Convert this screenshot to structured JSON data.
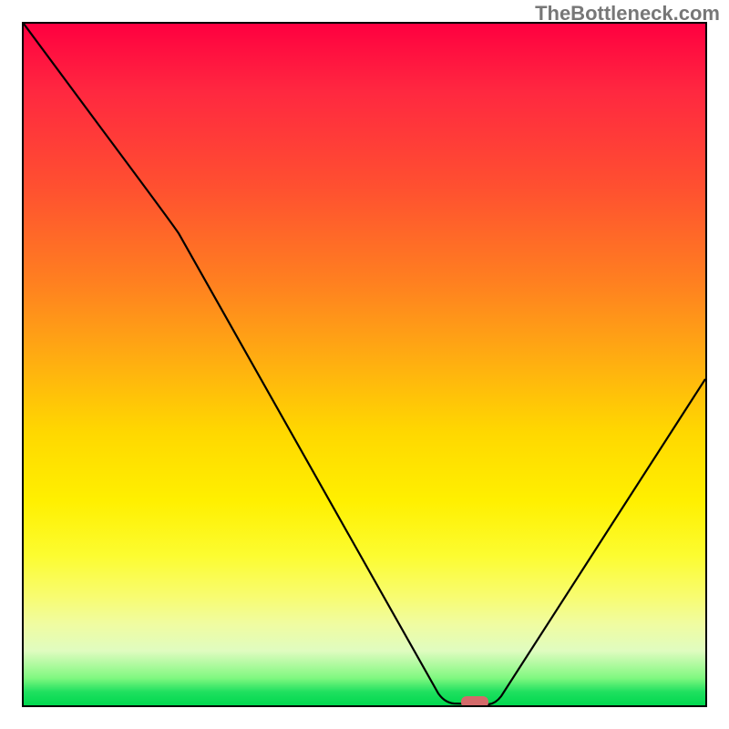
{
  "watermark": "TheBottleneck.com",
  "chart_data": {
    "type": "line",
    "title": "",
    "xlabel": "",
    "ylabel": "",
    "xlim": [
      0,
      100
    ],
    "ylim": [
      0,
      100
    ],
    "grid": false,
    "series": [
      {
        "name": "curve",
        "x": [
          0,
          22,
          62,
          63,
          69,
          70,
          100
        ],
        "y": [
          100,
          70,
          1,
          0,
          0,
          1,
          48
        ]
      }
    ],
    "marker": {
      "x": 66,
      "y": 0.5,
      "color": "#d46a6a",
      "shape": "rounded-rect"
    }
  },
  "colors": {
    "frame_border": "#000000",
    "curve_stroke": "#000000",
    "marker_fill": "#d46a6a",
    "watermark_text": "#777777"
  }
}
